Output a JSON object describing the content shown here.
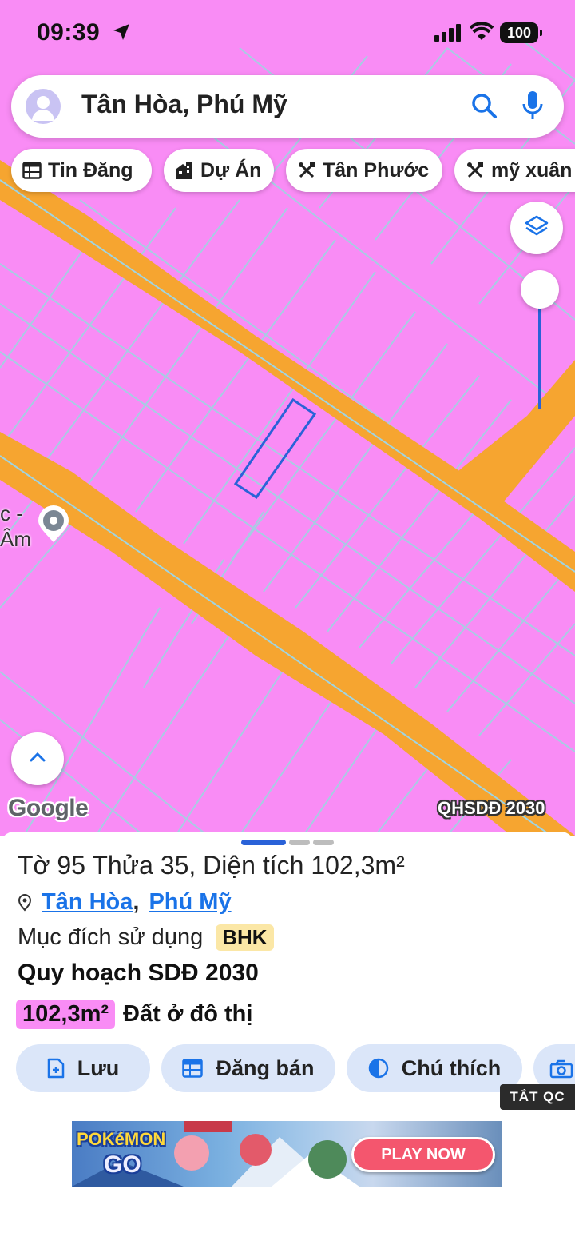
{
  "status_bar": {
    "time": "09:39",
    "battery": "100"
  },
  "search": {
    "text": "Tân Hòa, Phú Mỹ",
    "icons": [
      "avatar-icon",
      "search-icon",
      "mic-icon"
    ]
  },
  "chips": [
    {
      "label": "Tin Đăng",
      "icon": "table-icon"
    },
    {
      "label": "Dự Án",
      "icon": "building-icon"
    },
    {
      "label": "Tân Phước",
      "icon": "tools-icon"
    },
    {
      "label": "mỹ xuân",
      "icon": "tools-icon"
    }
  ],
  "map": {
    "location_label_line1": "c -",
    "location_label_line2": "Âm",
    "logo": "Google",
    "layer_badge": "QHSDĐ 2030",
    "colors": {
      "land": "#f98cf5",
      "road": "#f6a530",
      "parcel_lines": "#9fd4e2",
      "selected_parcel": "#2a62d8"
    }
  },
  "sheet": {
    "title": "Tờ 95 Thửa 35, Diện tích 102,3m²",
    "address": {
      "ward": "Tân Hòa",
      "separator": ",",
      "city": "Phú Mỹ"
    },
    "usage_label": "Mục đích sử dụng",
    "usage_code": "BHK",
    "plan_title": "Quy hoạch SDĐ 2030",
    "plan_area": "102,3m²",
    "plan_type": "Đất ở đô thị",
    "actions": [
      {
        "label": "Lưu",
        "icon": "save-doc-icon"
      },
      {
        "label": "Đăng bán",
        "icon": "table-icon"
      },
      {
        "label": "Chú thích",
        "icon": "contrast-icon"
      },
      {
        "label": "",
        "icon": "camera-plus-icon"
      }
    ]
  },
  "ads": {
    "close_label": "TẮT QC",
    "banner_logo_line1": "POKéMON",
    "banner_logo_line2": "GO",
    "banner_cta": "PLAY NOW"
  }
}
